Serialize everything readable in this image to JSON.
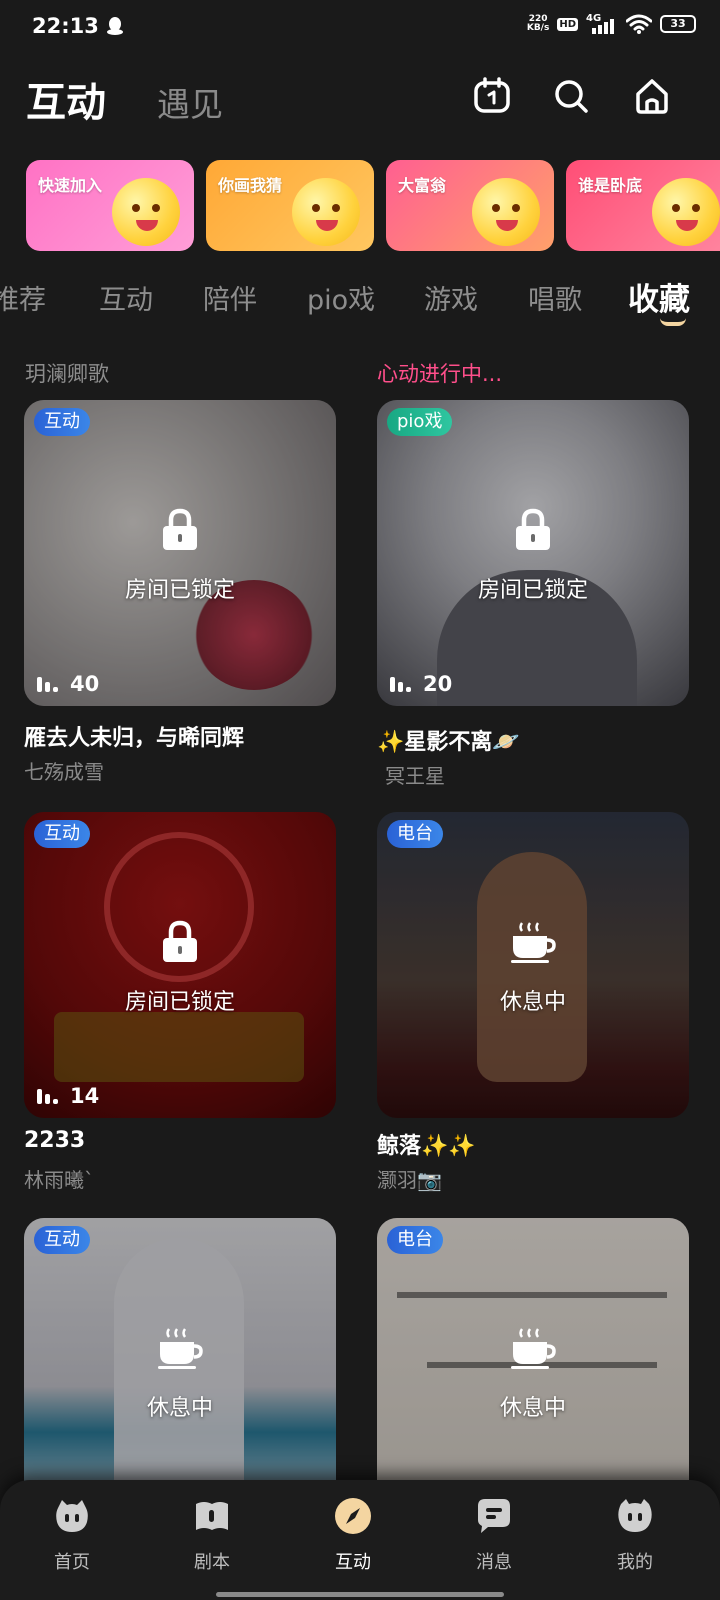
{
  "status_bar": {
    "time": "22:13",
    "net_speed_value": "220",
    "net_speed_unit": "KB/s",
    "hd": "HD",
    "network": "4G",
    "battery": "33"
  },
  "header": {
    "tab_active": "互动",
    "tab_inactive": "遇见"
  },
  "games": [
    {
      "title": "快速加入",
      "colors": [
        "#ff7bc6",
        "#ff9ad2"
      ]
    },
    {
      "title": "你画我猜",
      "colors": [
        "#ffb13c",
        "#ffc35f"
      ]
    },
    {
      "title": "大富翁",
      "colors": [
        "#ff6a8f",
        "#ff9f6a"
      ]
    },
    {
      "title": "谁是卧底",
      "colors": [
        "#ff5a7a",
        "#ff7f9a"
      ]
    }
  ],
  "categories": [
    "推荐",
    "互动",
    "陪伴",
    "pio戏",
    "游戏",
    "唱歌",
    "收藏"
  ],
  "active_category": "收藏",
  "columns": {
    "left_header": "玥澜卿歌",
    "right_header": "心动进行中..."
  },
  "rooms": [
    {
      "tag": "互动",
      "state": "房间已锁定",
      "count": "40",
      "title": "雁去人未归，与晞同辉",
      "owner": "七殇成雪"
    },
    {
      "tag": "pio戏",
      "state": "房间已锁定",
      "count": "20",
      "title": "✨星影不离🪐",
      "owner": "冥王星"
    },
    {
      "tag": "互动",
      "state": "房间已锁定",
      "count": "14",
      "title": "2233",
      "owner": "林雨曦`"
    },
    {
      "tag": "电台",
      "state": "休息中",
      "title": "鲸落✨✨",
      "owner": "灏羽📷"
    },
    {
      "tag": "互动",
      "state": "休息中"
    },
    {
      "tag": "电台",
      "state": "休息中"
    }
  ],
  "bottom_nav": [
    {
      "label": "首页",
      "icon": "cat-face-icon"
    },
    {
      "label": "剧本",
      "icon": "book-icon"
    },
    {
      "label": "互动",
      "icon": "compass-icon"
    },
    {
      "label": "消息",
      "icon": "chat-icon"
    },
    {
      "label": "我的",
      "icon": "profile-icon"
    }
  ],
  "colors": {
    "accent": "#f4d5a1",
    "pink_header": "#ff4f8b",
    "background": "#1a1a1a"
  }
}
